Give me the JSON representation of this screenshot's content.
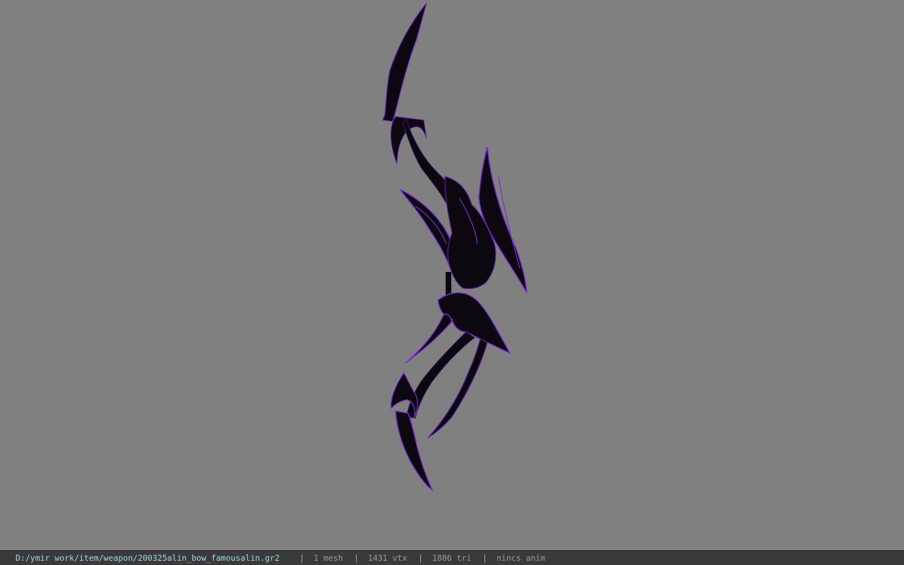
{
  "viewport": {
    "background_color": "#808080",
    "model": {
      "description_icon": "bow-model",
      "body_color": "#0d0710",
      "glow_color": "#7a2bd6"
    }
  },
  "statusbar": {
    "file_path": "D:/ymir work/item/weapon/200325alin_bow_famousalin.gr2",
    "separator": "|",
    "mesh_count": "1 mesh",
    "vertex_count": "1431 vtx",
    "triangle_count": "1886 tri",
    "anim_status": "nincs anim",
    "path_color": "#9fd8e8",
    "text_color": "#9a9a9a"
  }
}
